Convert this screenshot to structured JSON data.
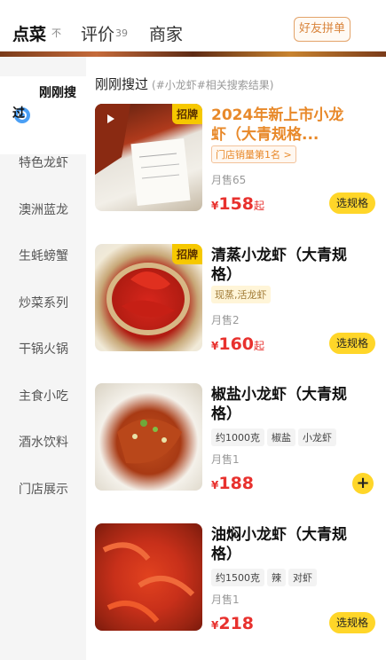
{
  "tabs": [
    {
      "label": "点菜",
      "badge": "不"
    },
    {
      "label": "评价",
      "badge": "39"
    },
    {
      "label": "商家"
    }
  ],
  "group_order_label": "好友拼单",
  "sidebar": {
    "active": "刚刚搜过",
    "items": [
      "特色龙虾",
      "澳洲蓝龙",
      "生蚝螃蟹",
      "炒菜系列",
      "干锅火锅",
      "主食小吃",
      "酒水饮料",
      "门店展示"
    ]
  },
  "section": {
    "title": "刚刚搜过",
    "subtitle": "(#小龙虾#相关搜索结果)"
  },
  "dishes": [
    {
      "name": "2024年新上市小龙虾（大青规格...",
      "badge": "招牌",
      "rank": "门店销量第1名 >",
      "sales": "月售65",
      "currency": "¥",
      "price": "158",
      "price_suffix": "起",
      "action": "选规格"
    },
    {
      "name": "清蒸小龙虾（大青规格）",
      "badge": "招牌",
      "tagline": "现蒸,活龙虾",
      "sales": "月售2",
      "currency": "¥",
      "price": "160",
      "price_suffix": "起",
      "action": "选规格"
    },
    {
      "name": "椒盐小龙虾（大青规格）",
      "tags": [
        "约1000克",
        "椒盐",
        "小龙虾"
      ],
      "sales": "月售1",
      "currency": "¥",
      "price": "188",
      "action": "+"
    },
    {
      "name": "油焖小龙虾（大青规格）",
      "tags": [
        "约1500克",
        "辣",
        "对虾"
      ],
      "sales": "月售1",
      "currency": "¥",
      "price": "218",
      "action": "选规格"
    }
  ],
  "colors": {
    "accent": "#ffd629",
    "price": "#e8312e",
    "orange": "#e8892a"
  }
}
